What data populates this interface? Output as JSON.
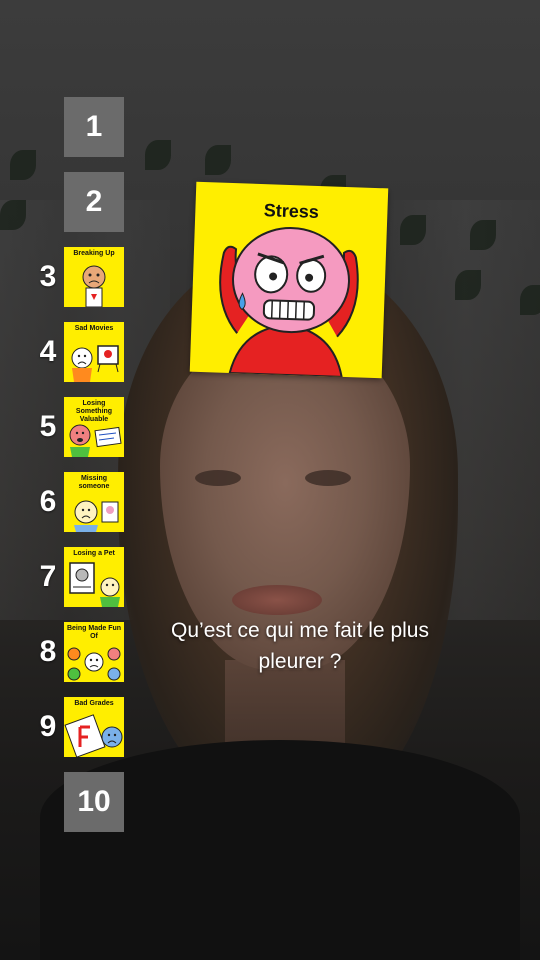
{
  "ranking": [
    {
      "rank": "1",
      "label": ""
    },
    {
      "rank": "2",
      "label": ""
    },
    {
      "rank": "3",
      "label": "Breaking Up"
    },
    {
      "rank": "4",
      "label": "Sad Movies"
    },
    {
      "rank": "5",
      "label": "Losing Something Valuable"
    },
    {
      "rank": "6",
      "label": "Missing someone"
    },
    {
      "rank": "7",
      "label": "Losing a Pet"
    },
    {
      "rank": "8",
      "label": "Being Made Fun Of"
    },
    {
      "rank": "9",
      "label": "Bad Grades"
    },
    {
      "rank": "10",
      "label": ""
    }
  ],
  "current_card": {
    "title": "Stress"
  },
  "caption": "Qu’est ce qui me fait le plus pleurer ?",
  "colors": {
    "card_bg": "#ffee00",
    "empty_slot": "#6b6b6b",
    "text": "#ffffff"
  }
}
